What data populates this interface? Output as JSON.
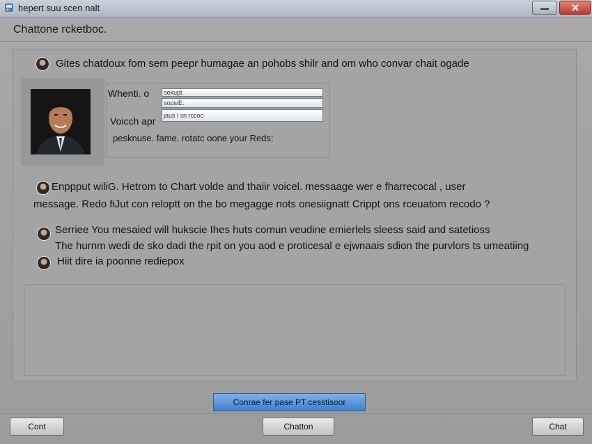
{
  "window": {
    "title": "hepert suu scen nalt"
  },
  "header": {
    "label": "Chattone rcketboc."
  },
  "intro": {
    "text": "Gites chatdoux fom sem peepr humagae an pohobs shilr and om who convar chait ogade"
  },
  "profile_form": {
    "label_when": "Whenti. o",
    "label_voice": "Voicch apr",
    "field1_value": "sekupt",
    "field2_value": "sopsiE.",
    "field3_value": "jaus l sn rccoc",
    "note": "pesknuse. fame. rotatc oone your Reds:"
  },
  "message_block": {
    "line1": "Enppput wiliG. Hetrom to Chart volde and thaiir voicel. messaage wer e fharrecocal , user",
    "line2": "message. Redo fiJut con reloptt on the bo megagge nots onesiignatt Crippt ons rceuatom recodo ?"
  },
  "service_block": {
    "line1": "Serriee You mesaied will hukscie Ihes huts comun veudine emierlels sleess said and satetioss",
    "line2": "The hurnm wedi de sko dadi the rpit on you aod e proticesal e ejwnaais sdion the purvlors ts umeatiing",
    "line3": "Hiit dire ia poonne rediepox"
  },
  "buttons": {
    "primary": "Conrae fer pase PT cesstisoor",
    "cancel": "Cont",
    "center": "Chatton",
    "chat": "Chat"
  },
  "colors": {
    "primary_button": "#3f7fcf",
    "close_button": "#c0392b",
    "window_bg": "#a3a3a3"
  },
  "icons": {
    "app": "app-icon",
    "minimize": "minimize-icon",
    "close": "close-icon"
  }
}
